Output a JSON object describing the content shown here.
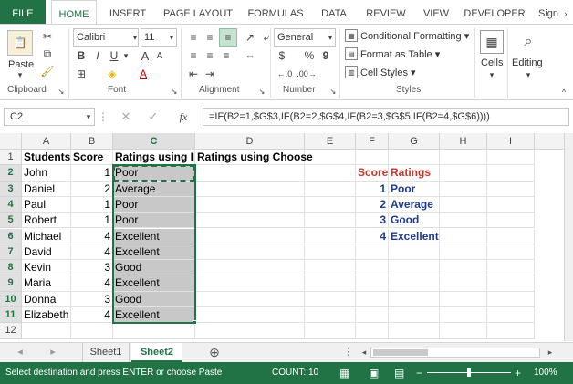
{
  "ribbon_tabs": [
    "FILE",
    "HOME",
    "INSERT",
    "PAGE LAYOUT",
    "FORMULAS",
    "DATA",
    "REVIEW",
    "VIEW",
    "DEVELOPER"
  ],
  "sign_in": "Sign",
  "clipboard": {
    "paste": "Paste",
    "label": "Clipboard"
  },
  "font": {
    "name": "Calibri",
    "size": "11",
    "label": "Font"
  },
  "alignment": {
    "label": "Alignment"
  },
  "number": {
    "format": "General",
    "currency": "$",
    "percent": "%",
    "comma": "9",
    "label": "Number"
  },
  "styles": {
    "conditional": "Conditional Formatting",
    "format_table": "Format as Table",
    "cell_styles": "Cell Styles",
    "label": "Styles"
  },
  "cells": {
    "label": "Cells"
  },
  "editing": {
    "label": "Editing"
  },
  "formula_bar": {
    "name_box": "C2",
    "fx": "fx",
    "formula": "=IF(B2=1,$G$3,IF(B2=2,$G$4,IF(B2=3,$G$5,IF(B2=4,$G$6))))"
  },
  "columns": [
    "A",
    "B",
    "C",
    "D",
    "E",
    "F",
    "G",
    "H",
    "I"
  ],
  "rows": [
    "1",
    "2",
    "3",
    "4",
    "5",
    "6",
    "7",
    "8",
    "9",
    "10",
    "11",
    "12"
  ],
  "headers": {
    "a": "Students",
    "b": "Score",
    "c": "Ratings using IF",
    "d": "Ratings using Choose"
  },
  "students": [
    {
      "name": "John",
      "score": "1",
      "rating": "Poor"
    },
    {
      "name": "Daniel",
      "score": "2",
      "rating": "Average"
    },
    {
      "name": "Paul",
      "score": "1",
      "rating": "Poor"
    },
    {
      "name": "Robert",
      "score": "1",
      "rating": "Poor"
    },
    {
      "name": "Michael",
      "score": "4",
      "rating": "Excellent"
    },
    {
      "name": "David",
      "score": "4",
      "rating": "Excellent"
    },
    {
      "name": "Kevin",
      "score": "3",
      "rating": "Good"
    },
    {
      "name": "Maria",
      "score": "4",
      "rating": "Excellent"
    },
    {
      "name": "Donna",
      "score": "3",
      "rating": "Good"
    },
    {
      "name": "Elizabeth",
      "score": "4",
      "rating": "Excellent"
    }
  ],
  "lookup": {
    "score_header": "Score",
    "ratings_header": "Ratings",
    "rows": [
      {
        "score": "1",
        "rating": "Poor"
      },
      {
        "score": "2",
        "rating": "Average"
      },
      {
        "score": "3",
        "rating": "Good"
      },
      {
        "score": "4",
        "rating": "Excellent"
      }
    ]
  },
  "sheets": [
    "Sheet1",
    "Sheet2"
  ],
  "active_sheet": "Sheet2",
  "status": {
    "message": "Select destination and press ENTER or choose Paste",
    "count": "COUNT: 10",
    "zoom": "100%"
  },
  "colors": {
    "accent": "#217346",
    "lookup_red": "#c0392b",
    "lookup_blue": "#1f3a93"
  }
}
